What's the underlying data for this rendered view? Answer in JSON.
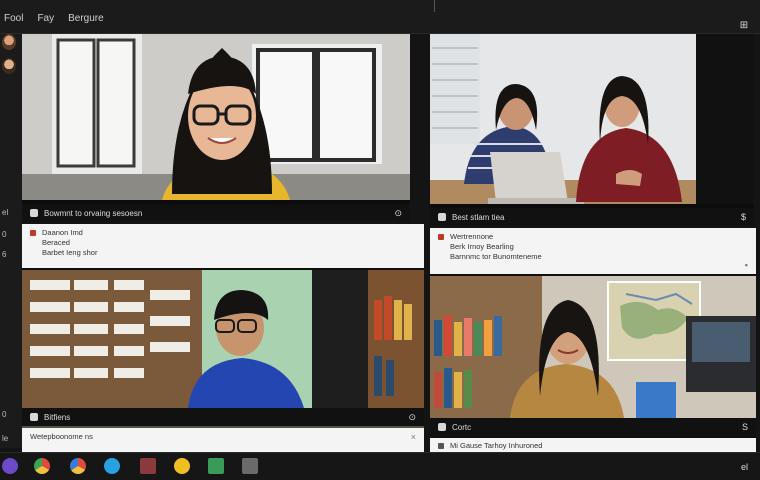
{
  "topbar": {
    "menu": [
      "Fool",
      "Fay",
      "Bergure"
    ],
    "panel_icon": "panel-icon"
  },
  "rail": {
    "labels": [
      "el",
      "0",
      "6",
      "0",
      "le"
    ]
  },
  "tiles": [
    {
      "id": "t1",
      "bar_label": "Bowmnt to orvaing sesoesn",
      "bar_end": "⊙"
    },
    {
      "id": "t2",
      "bar_label": "Best stlam tiea",
      "bar_end": "$"
    },
    {
      "id": "t3",
      "note_lines": [
        "Daanon Imd",
        "Beraced",
        "Barbet Ieng shor"
      ],
      "bar_label": "Bitfiens",
      "bar_end": "⊙",
      "note2": "Wetepboonome ns"
    },
    {
      "id": "t4",
      "note_lines": [
        "Wertrennone",
        "Berk Irnoy Bearling",
        "Barnnmc tor Bunomteneme"
      ],
      "bar_label": "Cortc",
      "bar_end": "S",
      "note2": "Mi Gause Tarhoy Inhuroned"
    }
  ],
  "taskbar": {
    "tray_label": "el"
  },
  "colors": {
    "background": "#141414",
    "note_background": "#f4f4f4",
    "accent_red": "#c0392b"
  }
}
